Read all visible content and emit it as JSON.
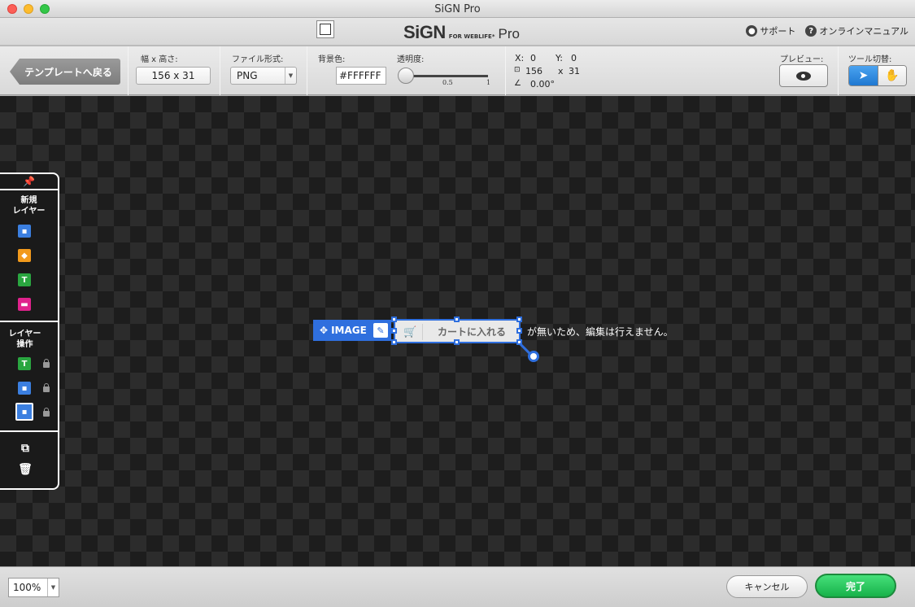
{
  "window": {
    "title": "SiGN Pro"
  },
  "brand": {
    "logo": "SiGN",
    "logo_sub": "FOR WEBLIFE*",
    "logo_pro": "Pro"
  },
  "help": {
    "support": "サポート",
    "manual": "オンラインマニュアル"
  },
  "toolbar": {
    "back_label": "テンプレートへ戻る",
    "size_label": "幅 x 高さ:",
    "size_value": "156 x 31",
    "format_label": "ファイル形式:",
    "format_value": "PNG",
    "bg_label": "背景色:",
    "bg_value": "#FFFFFF",
    "opacity_label": "透明度:",
    "opacity_ticks": [
      "0.5",
      "1"
    ],
    "x_label": "X:",
    "x_value": "0",
    "y_label": "Y:",
    "y_value": "0",
    "w_value": "156",
    "h_sep": "x",
    "h_value": "31",
    "angle_value": "0.00°",
    "preview_label": "プレビュー:",
    "tool_label": "ツール切替:"
  },
  "palette": {
    "new_layer": "新規\nレイヤー",
    "layer_ops": "レイヤー\n操作",
    "text_glyph": "T"
  },
  "canvas": {
    "object_tag": "IMAGE",
    "object_label": "カートに入れる",
    "message": "が無いため、編集は行えません。"
  },
  "bottom": {
    "zoom": "100%",
    "cancel": "キャンセル",
    "done": "完了"
  },
  "colors": {
    "accent": "#2f6fde",
    "done": "#17b24a",
    "canvas": "#1d1d1d"
  },
  "icons": [
    "pin-icon",
    "image-layer-icon",
    "shape-layer-icon",
    "text-layer-icon",
    "button-layer-icon",
    "lock-icon",
    "duplicate-icon",
    "trash-icon",
    "eye-icon",
    "arrow-tool-icon",
    "hand-tool-icon",
    "cart-icon",
    "move-icon",
    "pencil-icon"
  ]
}
